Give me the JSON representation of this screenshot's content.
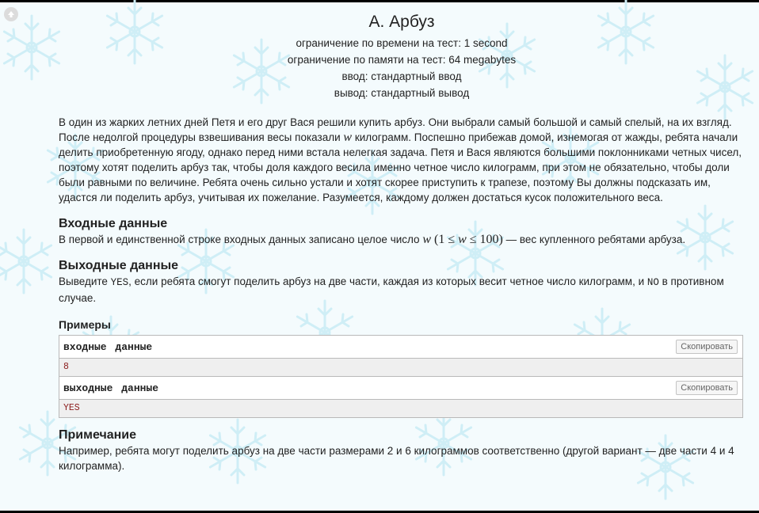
{
  "problem": {
    "title": "A. Арбуз",
    "time_limit": "ограничение по времени на тест: 1 second",
    "memory_limit": "ограничение по памяти на тест: 64 megabytes",
    "input": "ввод: стандартный ввод",
    "output": "вывод: стандартный вывод"
  },
  "legend": {
    "part1": "В один из жарких летних дней Петя и его друг Вася решили купить арбуз. Они выбрали самый большой и самый спелый, на их взгляд. После недолгой процедуры взвешивания весы показали ",
    "var_w": "w",
    "part2": " килограмм. Поспешно прибежав домой, изнемогая от жажды, ребята начали делить приобретенную ягоду, однако перед ними встала нелегкая задача. Петя и Вася являются большими поклонниками четных чисел, поэтому хотят поделить арбуз так, чтобы доля каждого весила именно четное число килограмм, при этом не обязательно, чтобы доли были равными по величине. Ребята очень сильно устали и хотят скорее приступить к трапезе, поэтому Вы должны подсказать им, удастся ли поделить арбуз, учитывая их пожелание. Разумеется, каждому должен достаться кусок положительного веса."
  },
  "input_spec": {
    "title": "Входные данные",
    "text_before": "В первой и единственной строке входных данных записано целое число ",
    "var_w": "w",
    "math_open": " (1 ≤ ",
    "math_var": "w",
    "math_close": " ≤ 100)",
    "text_after": " — вес купленного ребятами арбуза."
  },
  "output_spec": {
    "title": "Выходные данные",
    "text_before": "Выведите ",
    "yes": "YES",
    "text_middle": ", если ребята смогут поделить арбуз на две части, каждая из которых весит четное число килограмм, и ",
    "no": "NO",
    "text_after": " в противном случае."
  },
  "examples": {
    "title": "Примеры",
    "copy_label": "Скопировать",
    "input_label": "входные данные",
    "input_value": "8",
    "output_label": "выходные данные",
    "output_value": "YES"
  },
  "note": {
    "title": "Примечание",
    "text": "Например, ребята могут поделить арбуз на две части размерами 2 и 6 килограммов соответственно (другой вариант — две части 4 и 4 килограмма)."
  },
  "icons": {
    "back": "arrow-up-icon",
    "background": "snowflake-icon"
  },
  "colors": {
    "background": "#f4fbfd",
    "snowflake": "#cfeef6",
    "sample_output_text": "#8b1b1b"
  }
}
